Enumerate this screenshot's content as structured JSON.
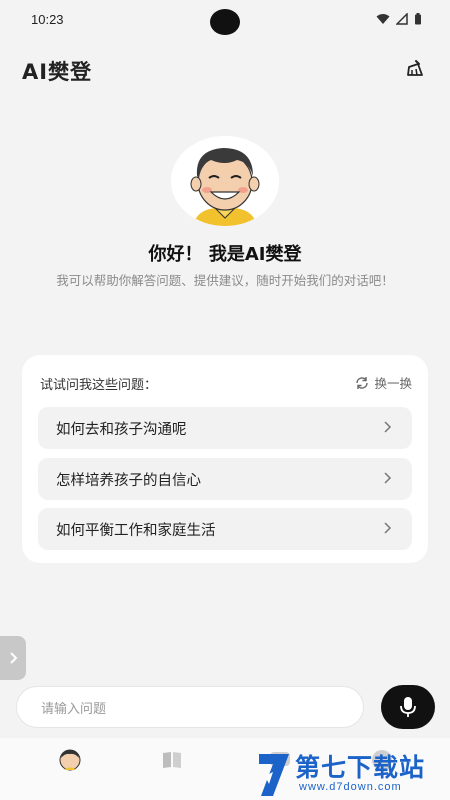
{
  "status_bar": {
    "time": "10:23"
  },
  "header": {
    "title": "AI樊登",
    "clean_icon": "broom-icon"
  },
  "profile": {
    "greeting": "你好！ 我是AI樊登",
    "intro": "我可以帮助你解答问题、提供建议，随时开始我们的对话吧！"
  },
  "suggestions": {
    "heading": "试试问我这些问题：",
    "refresh_label": "换一换",
    "questions": [
      "如何去和孩子沟通呢",
      "怎样培养孩子的自信心",
      "如何平衡工作和家庭生活"
    ]
  },
  "input": {
    "placeholder": "请输入问题"
  },
  "nav": {
    "items": [
      "avatar-icon",
      "book-icon",
      "chat-icon",
      "profile-icon"
    ]
  },
  "watermark": {
    "main": "第七下载站",
    "sub": "www.d7down.com"
  },
  "colors": {
    "accent": "#111111",
    "card": "#ffffff",
    "background": "#f3f3f3",
    "watermark": "#1c63c9"
  }
}
